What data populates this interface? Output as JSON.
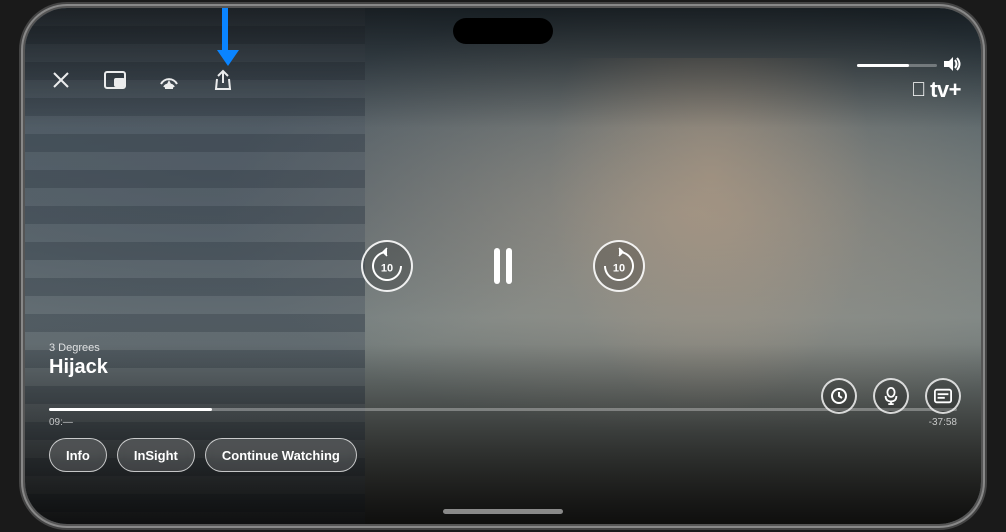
{
  "app": {
    "name": "Apple TV+",
    "logo_text": "tv+",
    "apple_symbol": ""
  },
  "show": {
    "subtitle": "3 Degrees",
    "title": "Hijack"
  },
  "playback": {
    "current_time": "09:—",
    "remaining_time": "-37:58",
    "progress_percent": 18,
    "volume_percent": 65
  },
  "controls": {
    "close_label": "✕",
    "pip_label": "⧉",
    "airplay_label": "⬛",
    "share_label": "↑",
    "skip_back_seconds": "10",
    "skip_forward_seconds": "10",
    "pause_label": "pause"
  },
  "bottom_buttons": {
    "info_label": "Info",
    "insight_label": "InSight",
    "continue_label": "Continue Watching"
  },
  "right_controls": {
    "speed_label": "⏱",
    "audio_label": "🔊",
    "subtitles_label": "💬"
  },
  "arrow": {
    "color": "#0a84ff",
    "pointing_to": "airplay-button"
  }
}
